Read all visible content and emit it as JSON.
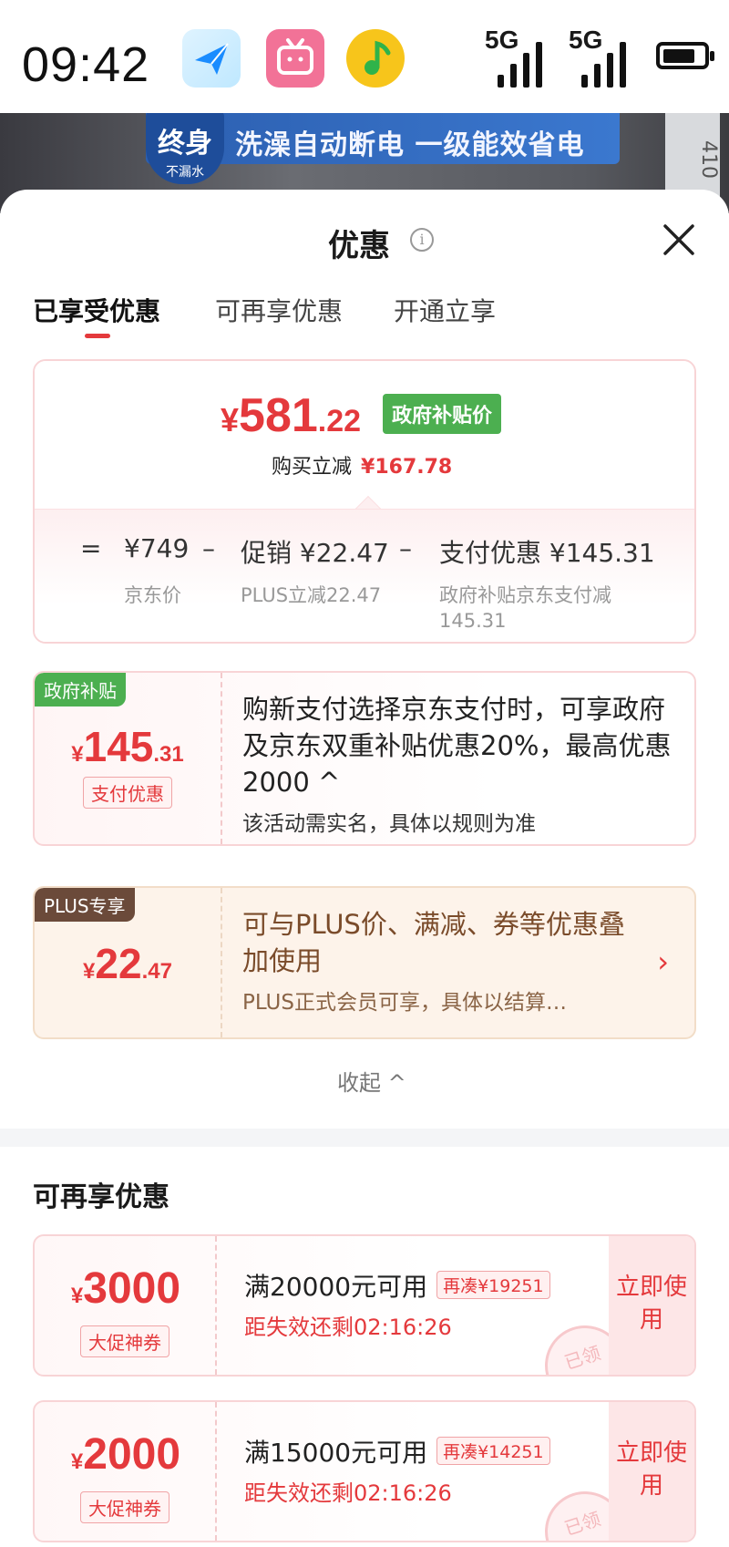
{
  "status_bar": {
    "time": "09:42",
    "signal1": "5G",
    "signal2": "5G",
    "battery_level": 0.8
  },
  "banner": {
    "shield_title": "终身",
    "shield_sub": "不漏水",
    "text": "洗澡自动断电 一级能效省电",
    "ruler_text": "410"
  },
  "sheet": {
    "title": "优惠",
    "info_icon": "info-icon",
    "close_icon": "close-icon"
  },
  "tabs": [
    {
      "label": "已享受优惠",
      "active": true
    },
    {
      "label": "可再享优惠",
      "active": false
    },
    {
      "label": "开通立享",
      "active": false
    }
  ],
  "summary": {
    "currency": "¥",
    "price_int": "581",
    "price_dec": ".22",
    "badge": "政府补贴价",
    "reduce_label": "购买立减",
    "reduce_value": "¥167.78",
    "eq_sign": "=",
    "items": [
      {
        "value": "¥749",
        "sub": "京东价"
      },
      {
        "op": "–",
        "value": "促销 ¥22.47",
        "sub": "PLUS立减22.47"
      },
      {
        "op": "–",
        "value": "支付优惠 ¥145.31",
        "sub": "政府补贴京东支付减145.31"
      }
    ]
  },
  "subsidy_card": {
    "tag": "政府补贴",
    "currency": "¥",
    "int": "145",
    "dec": ".31",
    "chip": "支付优惠",
    "main": "购新支付选择京东支付时，可享政府及京东双重补贴优惠20%，最高优惠2000 ^",
    "sub": "该活动需实名，具体以规则为准"
  },
  "plus_card": {
    "tag": "PLUS专享",
    "currency": "¥",
    "int": "22",
    "dec": ".47",
    "main": "可与PLUS价、满减、券等优惠叠加使用",
    "sub": "PLUS正式会员可享，具体以结算…",
    "arrow": "›"
  },
  "collapse_label": "收起 ^",
  "section_title": "可再享优惠",
  "coupons": [
    {
      "currency": "¥",
      "amount": "3000",
      "chip": "大促神券",
      "condition": "满20000元可用",
      "gap": "再凑¥19251",
      "expiry": "距失效还剩02:16:26",
      "use_label": "立即使用",
      "stamp": "已领"
    },
    {
      "currency": "¥",
      "amount": "2000",
      "chip": "大促神券",
      "condition": "满15000元可用",
      "gap": "再凑¥14251",
      "expiry": "距失效还剩02:16:26",
      "use_label": "立即使用",
      "stamp": "已领"
    }
  ],
  "colors": {
    "accent_red": "#e4393c",
    "gov_green": "#4caf50",
    "plus_brown": "#6b4a3a"
  }
}
